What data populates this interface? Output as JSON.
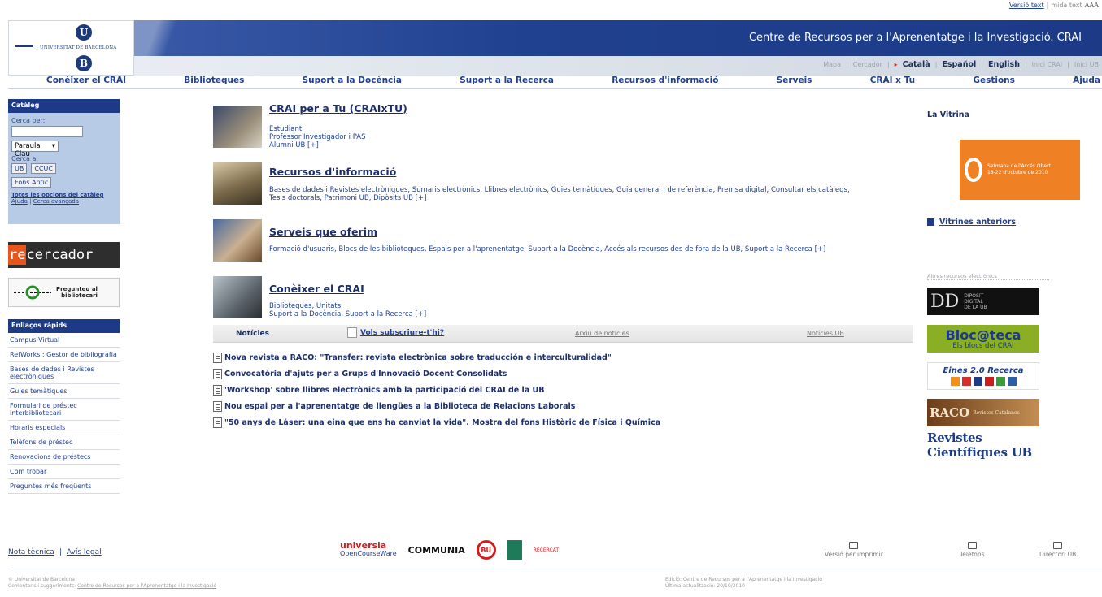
{
  "top_util": {
    "text_version": "Versió text",
    "text_size": "mida text",
    "aa": "AAA"
  },
  "header": {
    "logo_text": "UNIVERSITAT DE BARCELONA",
    "logo_top_letter": "U",
    "logo_bottom_letter": "B",
    "site_title": "Centre de Recursos per a l'Aprenentatge i la Investigació. CRAI",
    "util_links": [
      "Mapa",
      "Cercador"
    ],
    "languages": [
      "Català",
      "Español",
      "English"
    ],
    "home_links": [
      "Inici CRAI",
      "Inici UB"
    ]
  },
  "main_nav": [
    "Conèixer el CRAI",
    "Biblioteques",
    "Suport a la Docència",
    "Suport a la Recerca",
    "Recursos d'informació",
    "Serveis",
    "CRAI x Tu",
    "Gestions",
    "Ajuda"
  ],
  "catalog": {
    "title": "Catàleg",
    "search_by": "Cerca per:",
    "search_value": "",
    "select_value": "Paraula Clau",
    "search_in": "Cerca a:",
    "btn_ub": "UB",
    "btn_ccuc": "CCUC",
    "btn_fons": "Fons Antic",
    "link_all": "Totes les opcions del catàleg",
    "link_help": "Ajuda",
    "link_adv": "Cerca avançada"
  },
  "recercador": {
    "re": "re",
    "rest": "cercador"
  },
  "preguntau": {
    "line1": "Pregunteu al",
    "line2": "bibliotecari"
  },
  "quick_links": {
    "title": "Enllaços ràpids",
    "items": [
      "Campus Virtual",
      "RefWorks : Gestor de bibliografia",
      "Bases de dades i Revistes electròniques",
      "Guies temàtiques",
      "Formulari de préstec interbibliotecari",
      "Horaris especials",
      "Telèfons de préstec",
      "Renovacions de préstecs",
      "Com trobar",
      "Preguntes més freqüents"
    ]
  },
  "sections": [
    {
      "title": "CRAI per a Tu (CRAIxTU)",
      "body": [
        "Estudiant",
        "Professor Investigador i PAS",
        "Alumni UB [+]"
      ]
    },
    {
      "title": "Recursos d'informació",
      "body": [
        "Bases de dades i Revistes electròniques, Sumaris electrònics, Llibres electrònics, Guies temàtiques, Guia general i de referència, Premsa digital, Consultar els catàlegs,",
        "Tesis doctorals, Patrimoni UB, Dipòsits UB [+]"
      ]
    },
    {
      "title": "Serveis que oferim",
      "body": [
        "Formació d'usuaris, Blocs de les biblioteques, Espais per a l'aprenentatge, Suport a la Docència, Accés als recursos des de fora de la UB, Suport a la Recerca [+]"
      ]
    },
    {
      "title": "Conèixer el CRAI",
      "body": [
        "Biblioteques, Unitats",
        "Suport a la Docència, Suport a la Recerca [+]"
      ]
    }
  ],
  "news_tabs": {
    "noticies": "Notícies",
    "subscribe": "Vols subscriure-t'hi?",
    "archive": "Arxiu de notícies",
    "ub_news": "Notícies UB"
  },
  "news": [
    "Nova revista a RACO: \"Transfer: revista electrònica sobre traducción e interculturalidad\"",
    "Convocatòria d'ajuts per a Grups d'Innovació Docent Consolidats",
    "'Workshop' sobre llibres electrònics amb la participació del CRAI de la UB",
    "Nou espai per a l'aprenentatge de llengües a la Biblioteca de Relacions Laborals",
    "\"50 anys de Làser: una eina que ens ha canviat la vida\". Mostra del fons Històric de Física i Química"
  ],
  "right": {
    "vitrina_title": "La Vitrina",
    "banner_line1": "Setmana de l'Accés Obert",
    "banner_line2": "18-22 d'octubre de 2010",
    "vitrines_link": "Vitrines anteriors",
    "faded_heading": "Altres recursos electrònics",
    "res1_line1": "DIPÒSIT",
    "res1_line2": "DIGITAL",
    "res1_line3": "DE LA UB",
    "res2_title": "Bloc@teca",
    "res2_sub": "Els blocs del CRAI",
    "res3_title": "Eines 2.0 Recerca",
    "res4_title": "RACO",
    "res4_sub": "Revistes Catalanes",
    "res5_title": "Revistes Científiques UB"
  },
  "footer": {
    "nota": "Nota tècnica",
    "avis": "Avís legal",
    "universia": "universia",
    "ocw": "OpenCourseWare",
    "communia": "COMMUNIA",
    "ou": "BU",
    "recr": "RECERCAT",
    "print": "Versió per imprimir",
    "phones": "Telèfons",
    "directory": "Directori UB",
    "copyright1": "© Universitat de Barcelona",
    "copyright2": "Comentaris i suggeriments:",
    "copyright3": "Centre de Recursos per a l'Aprenentatge i la Investigació",
    "edition1": "Edició: Centre de Recursos per a l'Aprenentatge i la Investigació",
    "edition2": "Última actualització: 20/10/2010"
  },
  "colors": {
    "brand_blue": "#1d3a86",
    "accent_orange": "#f08024",
    "link": "#1f3f8f"
  }
}
